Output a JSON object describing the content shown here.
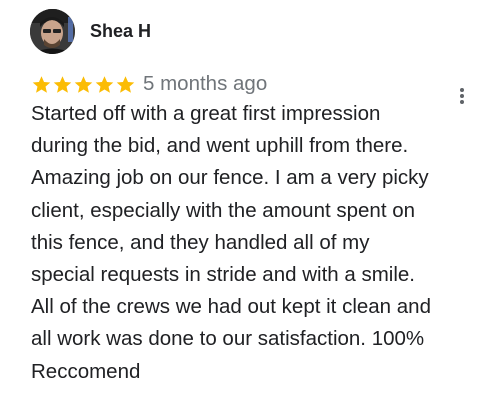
{
  "reviewer": {
    "name": "Shea H"
  },
  "rating": {
    "stars": 5,
    "max": 5,
    "star_color": "#fbbc04"
  },
  "review": {
    "time": "5 months ago",
    "text": "Started off with a great first impression\nduring the bid, and went uphill from there.\nAmazing job on our fence. I am a very picky\nclient, especially with the amount spent on\nthis fence, and they handled all of my\nspecial requests in stride and with a smile.\nAll of the crews we had out kept it clean and\nall work was done to our satisfaction. 100%\nReccomend"
  },
  "icons": {
    "more": "more-vert-icon",
    "star": "star-icon",
    "avatar": "profile-photo"
  },
  "colors": {
    "text": "#202124",
    "secondary_text": "#70757a",
    "icon": "#5f6368"
  }
}
